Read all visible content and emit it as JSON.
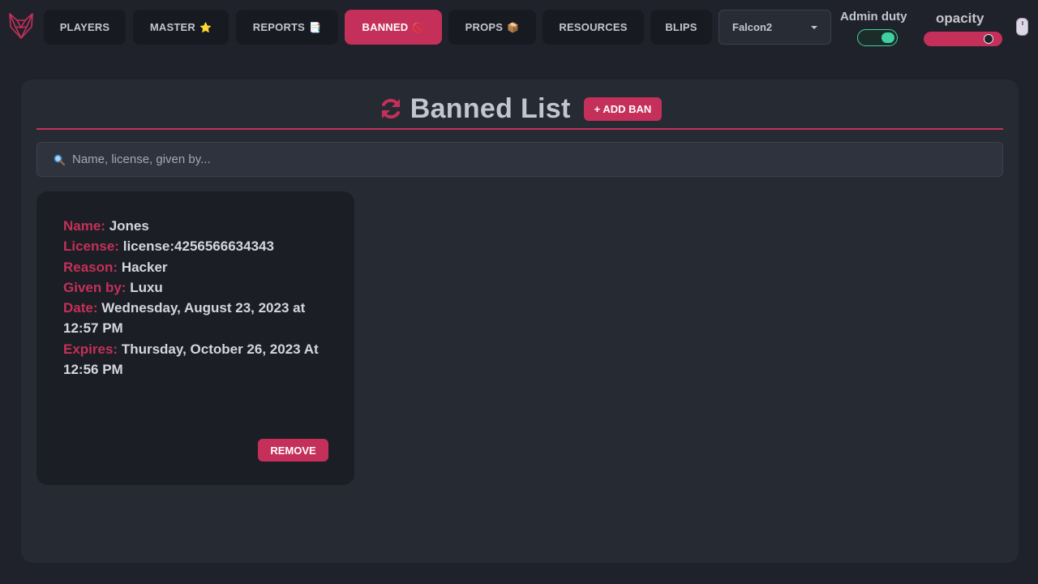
{
  "nav": {
    "items": [
      {
        "label": "PLAYERS",
        "emoji": ""
      },
      {
        "label": "MASTER",
        "emoji": "⭐"
      },
      {
        "label": "REPORTS",
        "emoji": "📑"
      },
      {
        "label": "BANNED",
        "emoji": "🚫"
      },
      {
        "label": "PROPS",
        "emoji": "📦"
      },
      {
        "label": "RESOURCES",
        "emoji": ""
      },
      {
        "label": "BLIPS",
        "emoji": ""
      }
    ],
    "active_index": 3
  },
  "server_select": {
    "value": "Falcon2"
  },
  "admin_duty": {
    "label": "Admin duty",
    "on": true
  },
  "opacity": {
    "label": "opacity",
    "value": 0.9
  },
  "main": {
    "title": "Banned List",
    "add_ban_label": "+ ADD BAN",
    "search_placeholder": "Name, license, given by..."
  },
  "bans": [
    {
      "name_label": "Name:",
      "name": "Jones",
      "license_label": "License:",
      "license": "license:4256566634343",
      "reason_label": "Reason:",
      "reason": "Hacker",
      "given_by_label": "Given by:",
      "given_by": "Luxu",
      "date_label": "Date:",
      "date": "Wednesday, August 23, 2023 at 12:57 PM",
      "expires_label": "Expires:",
      "expires": "Thursday, October 26, 2023 At 12:56 PM",
      "remove_label": "REMOVE"
    }
  ],
  "colors": {
    "accent": "#c5305a",
    "toggle_on": "#3fd1a2",
    "background": "#1f222a",
    "panel": "#262a33",
    "card": "#1b1e24"
  }
}
